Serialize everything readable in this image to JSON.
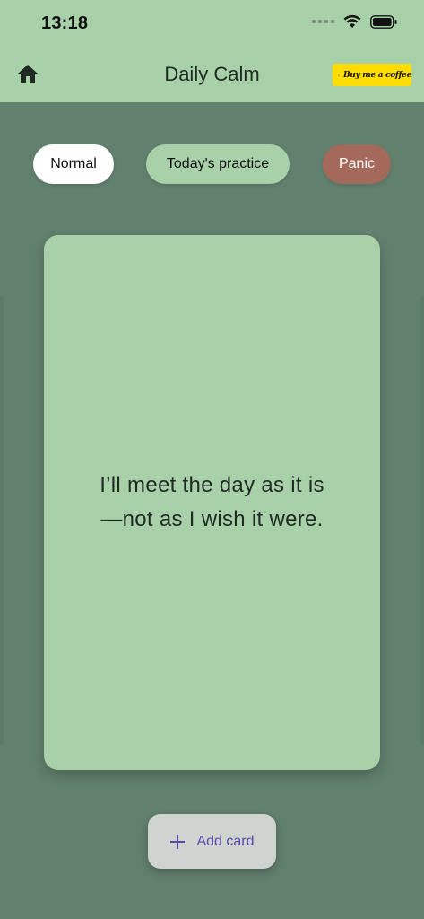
{
  "status": {
    "time": "13:18"
  },
  "header": {
    "title": "Daily Calm",
    "coffee_label": "Buy me a coffee"
  },
  "modes": [
    {
      "label": "Normal"
    },
    {
      "label": "Today's practice"
    },
    {
      "label": "Panic"
    }
  ],
  "card": {
    "line1": "I’ll meet the day as it is",
    "line2": "—not as I wish it were."
  },
  "add_card": {
    "label": "Add card"
  },
  "colors": {
    "header_bg": "#a8d1aa",
    "background": "#62806e",
    "panic": "#a4695b",
    "accent": "#5a4aa6",
    "coffee": "#ffdd00"
  }
}
